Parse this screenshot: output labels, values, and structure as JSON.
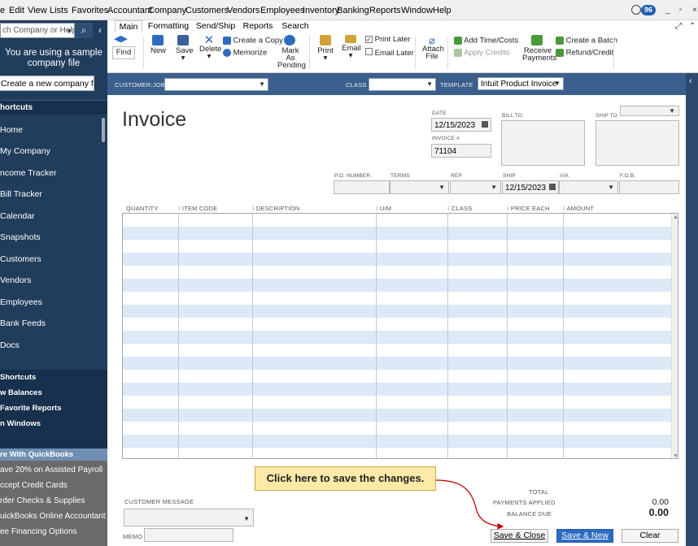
{
  "menubar": {
    "items": [
      "e",
      "Edit",
      "View",
      "Lists",
      "Favorites",
      "Accountant",
      "Company",
      "Customers",
      "Vendors",
      "Employees",
      "Inventory",
      "Banking",
      "Reports",
      "Window",
      "Help"
    ],
    "reminder_count": "96",
    "window_controls": [
      "_",
      "▫",
      "×"
    ]
  },
  "sidebar": {
    "search_placeholder": "ch Company or Help",
    "sample_notice": "You are using a sample company file",
    "create_button": "Create a new company file",
    "shortcuts_header": "hortcuts",
    "shortcut_items": [
      "Home",
      "My Company",
      "ncome Tracker",
      "Bill Tracker",
      "Calendar",
      "Snapshots",
      "Customers",
      "Vendors",
      "Employees",
      "Bank Feeds",
      "Docs"
    ],
    "section_items": [
      "Shortcuts",
      "w Balances",
      "Favorite Reports",
      "n Windows"
    ],
    "quickbooks_header": "re With QuickBooks",
    "more_items": [
      "ave 20% on Assisted Payroll",
      "ccept Credit Cards",
      "rder Checks & Supplies",
      "uickBooks Online Accountant",
      "ee Financing Options"
    ]
  },
  "tabs": [
    "Main",
    "Formatting",
    "Send/Ship",
    "Reports",
    "Search"
  ],
  "toolbar": {
    "find": "Find",
    "new": "New",
    "save": "Save",
    "delete": "Delete",
    "create_copy": "Create a Copy",
    "memorize": "Memorize",
    "mark_as_pending": "Mark As Pending",
    "print": "Print",
    "email": "Email",
    "print_later": "Print Later",
    "email_later": "Email Later",
    "attach_file": "Attach File",
    "add_time_costs": "Add Time/Costs",
    "apply_credits": "Apply Credits",
    "receive_payments": "Receive Payments",
    "create_batch": "Create a Batch",
    "refund_credit": "Refund/Credit"
  },
  "header": {
    "customer_job_label": "CUSTOMER:JOB",
    "customer_job_value": "",
    "class_label": "CLASS",
    "template_label": "TEMPLATE",
    "template_value": "Intuit Product Invoice"
  },
  "invoice": {
    "title": "Invoice",
    "date_label": "DATE",
    "date_value": "12/15/2023",
    "invoice_no_label": "INVOICE #",
    "invoice_no_value": "71104",
    "bill_to_label": "BILL TO",
    "ship_to_label": "SHIP TO",
    "po_label": "P.O. NUMBER",
    "terms_label": "TERMS",
    "rep_label": "REP",
    "ship_label": "SHIP",
    "ship_value": "12/15/2023",
    "via_label": "VIA",
    "fob_label": "F.O.B.",
    "columns": [
      "QUANTITY",
      "ITEM CODE",
      "DESCRIPTION",
      "U/M",
      "CLASS",
      "PRICE EACH",
      "AMOUNT"
    ]
  },
  "footer": {
    "customer_message_label": "CUSTOMER MESSAGE",
    "memo_label": "MEMO",
    "total_label": "TOTAL",
    "payments_applied_label": "PAYMENTS APPLIED",
    "payments_applied_value": "0.00",
    "balance_due_label": "BALANCE DUE",
    "balance_due_value": "0.00",
    "save_close": "Save & Close",
    "save_new": "Save & New",
    "clear": "Clear"
  },
  "callout": "Click here to save the changes.",
  "colors": {
    "sidebar": "#213d5c",
    "header_strip": "#3b5f8c",
    "row_stripe": "#dde9f7",
    "primary_button": "#2d6bc0",
    "callout": "#fde9a8",
    "arrow": "#c00000"
  }
}
